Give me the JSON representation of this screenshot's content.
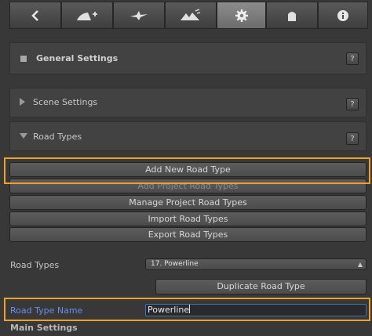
{
  "toolbar": {
    "tabs": [
      {
        "icon": "back-arrow-icon"
      },
      {
        "icon": "add-road-icon"
      },
      {
        "icon": "intersection-icon"
      },
      {
        "icon": "terrain-icon"
      },
      {
        "icon": "gear-icon",
        "selected": true
      },
      {
        "icon": "building-icon"
      },
      {
        "icon": "info-icon"
      }
    ]
  },
  "general_settings": {
    "title": "General Settings",
    "help": "?"
  },
  "scene_settings": {
    "title": "Scene Settings",
    "help": "?"
  },
  "road_types_section": {
    "title": "Road Types",
    "help": "?"
  },
  "buttons": {
    "add_new_road_type": "Add New Road Type",
    "add_project_road_types": "Add Project Road Types",
    "manage_project_road_types": "Manage Project Road Types",
    "import_road_types": "Import Road Types",
    "export_road_types": "Export Road Types",
    "duplicate_road_type": "Duplicate Road Type"
  },
  "road_types_field": {
    "label": "Road Types",
    "selected": "17. Powerline"
  },
  "road_type_name_field": {
    "label": "Road Type Name",
    "value": "Powerline"
  },
  "main_settings": {
    "label": "Main Settings"
  },
  "colors": {
    "highlight": "#f0a12a",
    "focus_label": "#6a8fe8"
  }
}
